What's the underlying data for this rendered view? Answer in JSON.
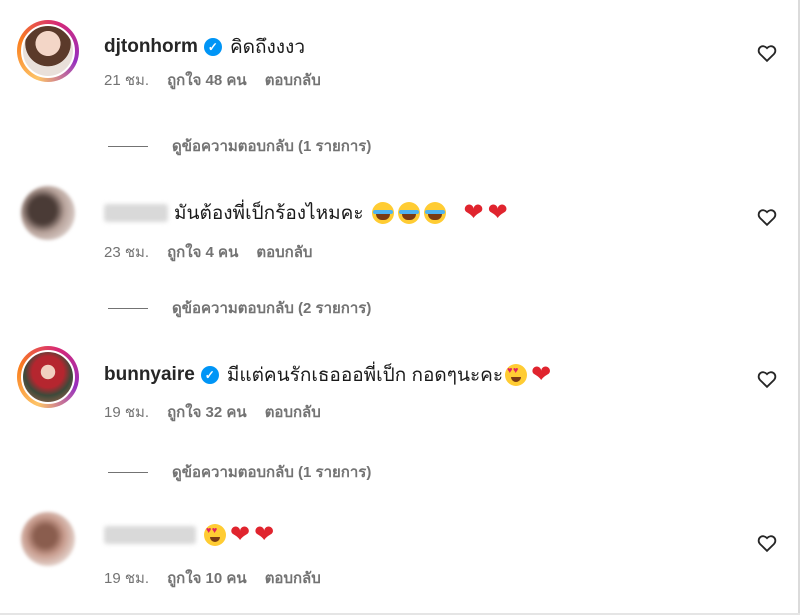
{
  "comments": [
    {
      "username": "djtonhorm",
      "verified": true,
      "text": "คิดถึงงงว",
      "time": "21 ชม.",
      "likes": "ถูกใจ 48 คน",
      "reply": "ตอบกลับ",
      "view_replies": "ดูข้อความตอบกลับ (1 รายการ)"
    },
    {
      "username": "",
      "verified": false,
      "text": "มันต้องพี่เป็กร้องไหมคะ",
      "emojis": [
        "joy-icon",
        "joy-icon",
        "joy-icon",
        "heart-icon",
        "heart-icon"
      ],
      "time": "23 ชม.",
      "likes": "ถูกใจ 4 คน",
      "reply": "ตอบกลับ",
      "view_replies": "ดูข้อความตอบกลับ (2 รายการ)"
    },
    {
      "username": "bunnyaire",
      "verified": true,
      "text": "มีแต่คนรักเธอออพี่เป็ก กอดๆนะคะ",
      "emojis": [
        "heart-eyes-icon",
        "heart-icon"
      ],
      "time": "19 ชม.",
      "likes": "ถูกใจ 32 คน",
      "reply": "ตอบกลับ",
      "view_replies": "ดูข้อความตอบกลับ (1 รายการ)"
    },
    {
      "username": "",
      "verified": false,
      "text": "",
      "emojis": [
        "heart-eyes-icon",
        "heart-icon",
        "heart-icon"
      ],
      "time": "19 ชม.",
      "likes": "ถูกใจ 10 คน",
      "reply": "ตอบกลับ"
    }
  ],
  "icons": {
    "heart_glyph": "❤",
    "verified_glyph": "✓"
  },
  "colors": {
    "verified": "#0095f6",
    "heart": "#e0242e",
    "meta": "#737373"
  }
}
